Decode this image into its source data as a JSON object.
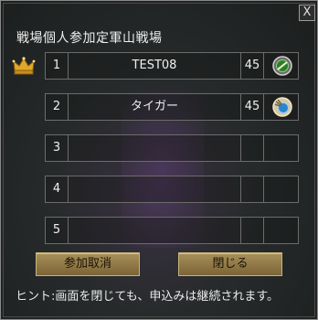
{
  "window": {
    "close_label": "X",
    "title": "戦場個人参加定軍山戦場"
  },
  "entries": [
    {
      "rank": "1",
      "name": "TEST08",
      "level": "45",
      "emblem": "green-emblem-icon"
    },
    {
      "rank": "2",
      "name": "タイガー",
      "level": "45",
      "emblem": "blue-emblem-icon"
    },
    {
      "rank": "3",
      "name": "",
      "level": "",
      "emblem": ""
    },
    {
      "rank": "4",
      "name": "",
      "level": "",
      "emblem": ""
    },
    {
      "rank": "5",
      "name": "",
      "level": "",
      "emblem": ""
    }
  ],
  "buttons": {
    "cancel": "参加取消",
    "close": "閉じる"
  },
  "hint": "ヒント:画面を閉じても、申込みは継続されます。",
  "colors": {
    "button_gold": "#a8905a",
    "green_emblem": "#3d9b3a",
    "blue_emblem": "#3a8fd0"
  }
}
